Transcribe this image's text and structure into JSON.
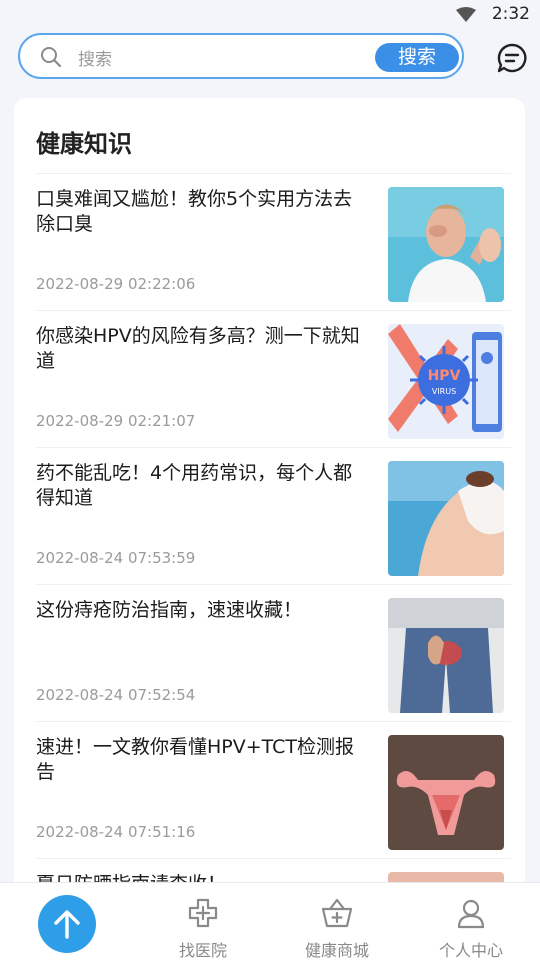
{
  "status_bar": {
    "time": "2:32"
  },
  "search": {
    "placeholder": "搜索",
    "button_label": "搜索"
  },
  "section": {
    "title": "健康知识"
  },
  "articles": [
    {
      "title": "口臭难闻又尴尬！教你5个实用方法去除口臭",
      "date": "2022-08-29 02:22:06"
    },
    {
      "title": "你感染HPV的风险有多高？测一下就知道",
      "date": "2022-08-29 02:21:07",
      "thumb_text": "HPV",
      "thumb_subtext": "VIRUS"
    },
    {
      "title": "药不能乱吃！4个用药常识，每个人都得知道",
      "date": "2022-08-24 07:53:59"
    },
    {
      "title": "这份痔疮防治指南，速速收藏！",
      "date": "2022-08-24 07:52:54"
    },
    {
      "title": "速进！一文教你看懂HPV+TCT检测报告",
      "date": "2022-08-24 07:51:16"
    },
    {
      "title": "夏日防晒指南请查收！",
      "date": ""
    }
  ],
  "tabbar": {
    "items": [
      {
        "label": "找医院",
        "icon": "hospital-cross-icon"
      },
      {
        "label": "健康商城",
        "icon": "shopping-basket-icon"
      },
      {
        "label": "个人中心",
        "icon": "person-icon"
      }
    ],
    "fab_icon": "arrow-up-icon"
  },
  "colors": {
    "accent": "#3b8fe6",
    "fab": "#2f9ee8",
    "search_border": "#5aa6ee"
  }
}
